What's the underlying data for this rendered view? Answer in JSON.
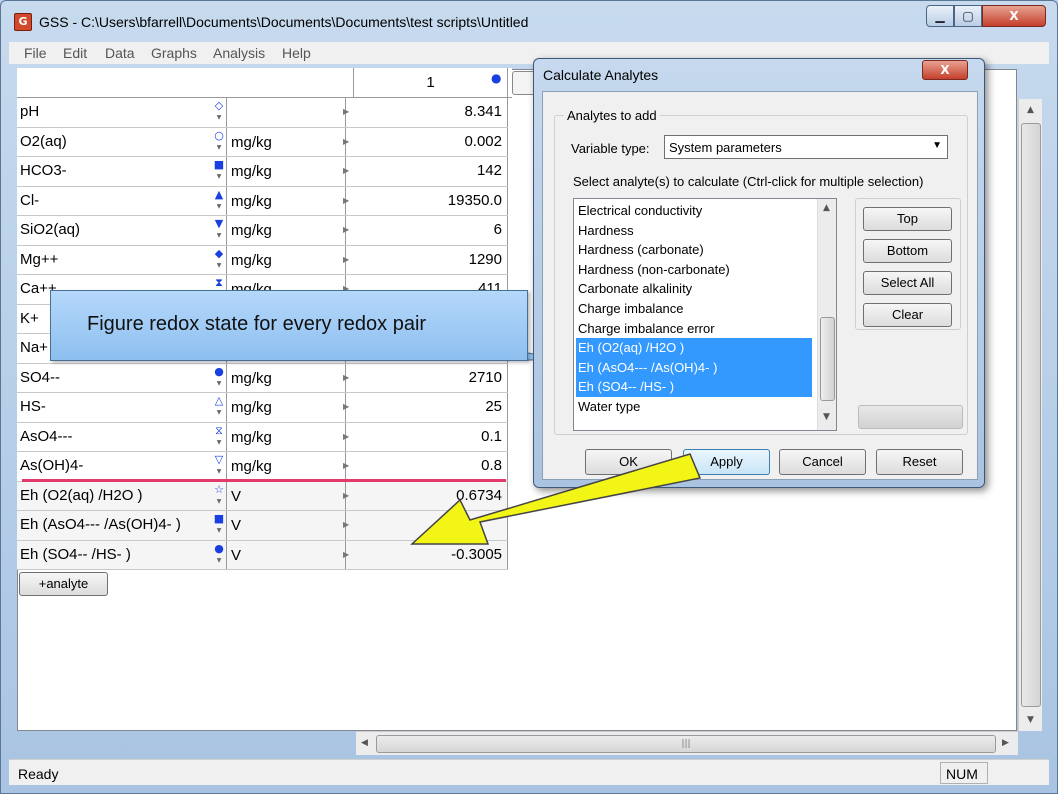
{
  "window": {
    "title": "GSS - C:\\Users\\bfarrell\\Documents\\Documents\\Documents\\test scripts\\Untitled",
    "icon": "gss-app-icon",
    "min_label": "▁",
    "max_label": "▢",
    "close_label": "X"
  },
  "menu": {
    "items": [
      "File",
      "Edit",
      "Data",
      "Graphs",
      "Analysis",
      "Help"
    ]
  },
  "grid": {
    "column_number": "1",
    "rows": [
      {
        "name": "pH",
        "symbol": "◇",
        "unit": "",
        "value": "8.341",
        "kind": "input"
      },
      {
        "name": "O2(aq)",
        "symbol": "○",
        "unit": "mg/kg",
        "value": "0.002",
        "kind": "input"
      },
      {
        "name": "HCO3-",
        "symbol": "■",
        "unit": "mg/kg",
        "value": "142",
        "kind": "input"
      },
      {
        "name": "Cl-",
        "symbol": "▲",
        "unit": "mg/kg",
        "value": "19350.0",
        "kind": "input"
      },
      {
        "name": "SiO2(aq)",
        "symbol": "▼",
        "unit": "mg/kg",
        "value": "6",
        "kind": "input"
      },
      {
        "name": "Mg++",
        "symbol": "◆",
        "unit": "mg/kg",
        "value": "1290",
        "kind": "input"
      },
      {
        "name": "Ca++",
        "symbol": "⧗",
        "unit": "mg/kg",
        "value": "411",
        "kind": "input"
      },
      {
        "name": "K+",
        "symbol": "",
        "unit": "",
        "value": "",
        "kind": "input"
      },
      {
        "name": "Na+",
        "symbol": "",
        "unit": "",
        "value": "",
        "kind": "input"
      },
      {
        "name": "SO4--",
        "symbol": "●",
        "unit": "mg/kg",
        "value": "2710",
        "kind": "input"
      },
      {
        "name": "HS-",
        "symbol": "△",
        "unit": "mg/kg",
        "value": "25",
        "kind": "input"
      },
      {
        "name": "AsO4---",
        "symbol": "⧖",
        "unit": "mg/kg",
        "value": "0.1",
        "kind": "input"
      },
      {
        "name": "As(OH)4-",
        "symbol": "▽",
        "unit": "mg/kg",
        "value": "0.8",
        "kind": "input"
      },
      {
        "name": "Eh (O2(aq) /H2O  )",
        "symbol": "☆",
        "unit": "V",
        "value": "0.6734",
        "kind": "calc"
      },
      {
        "name": "Eh (AsO4--- /As(OH)4-  )",
        "symbol": "■",
        "unit": "V",
        "value": "",
        "kind": "calc"
      },
      {
        "name": "Eh (SO4-- /HS-  )",
        "symbol": "●",
        "unit": "V",
        "value": "-0.3005",
        "kind": "calc"
      }
    ],
    "add_button": "+analyte"
  },
  "callout": {
    "text": "Figure redox state for every redox pair"
  },
  "dialog": {
    "title": "Calculate Analytes",
    "close_label": "X",
    "group_label": "Analytes to add",
    "variable_type_label": "Variable type:",
    "variable_type_value": "System parameters",
    "select_hint": "Select analyte(s) to calculate (Ctrl-click for multiple selection)",
    "list": [
      {
        "label": "Electrical conductivity",
        "selected": false
      },
      {
        "label": "Hardness",
        "selected": false
      },
      {
        "label": "Hardness (carbonate)",
        "selected": false
      },
      {
        "label": "Hardness (non-carbonate)",
        "selected": false
      },
      {
        "label": "Carbonate alkalinity",
        "selected": false
      },
      {
        "label": "Charge imbalance",
        "selected": false
      },
      {
        "label": "Charge imbalance error",
        "selected": false
      },
      {
        "label": "Eh (O2(aq) /H2O  )",
        "selected": true
      },
      {
        "label": "Eh (AsO4--- /As(OH)4-  )",
        "selected": true
      },
      {
        "label": "Eh (SO4-- /HS-  )",
        "selected": true
      },
      {
        "label": "Water type",
        "selected": false
      }
    ],
    "side_buttons": [
      "Top",
      "Bottom",
      "Select All",
      "Clear"
    ],
    "ok": "OK",
    "apply": "Apply",
    "cancel": "Cancel",
    "reset": "Reset"
  },
  "status": {
    "text": "Ready",
    "num": "NUM"
  },
  "colors": {
    "accent": "#1a3fe0",
    "selection": "#3399ff",
    "callout": "#9ccaf5",
    "arrow": "#f2f516",
    "divider": "#e23a6a"
  }
}
